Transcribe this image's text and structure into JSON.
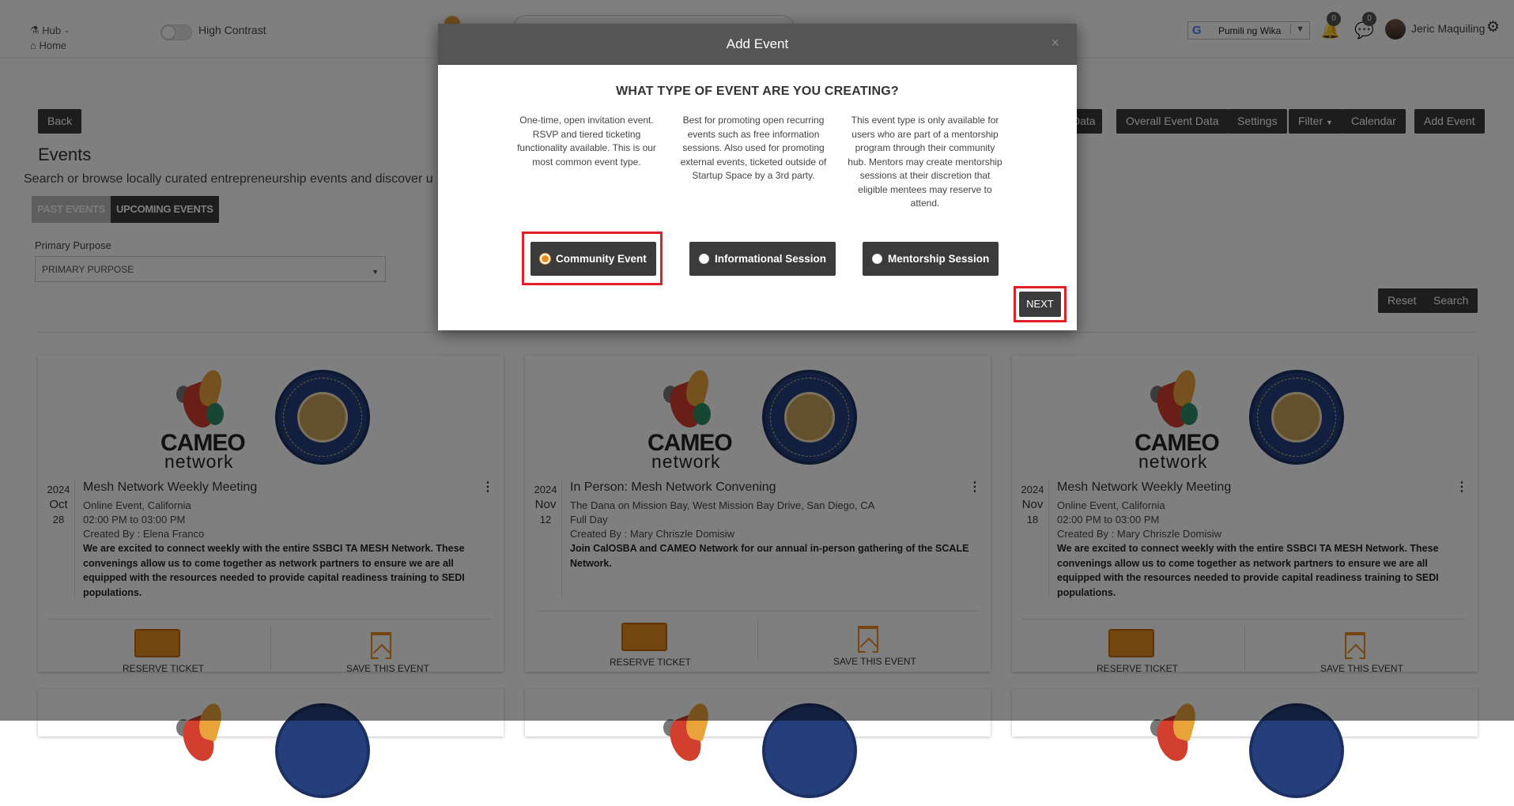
{
  "topbar": {
    "hub_label": "Hub",
    "home_label": "Home",
    "high_contrast_label": "High Contrast",
    "language_label": "Pumili ng Wika",
    "notifications_count": "0",
    "messages_count": "0",
    "user_name": "Jeric Maquiling"
  },
  "page": {
    "back_label": "Back",
    "title": "Events",
    "subtitle": "Search or browse locally curated entrepreneurship events and discover u",
    "toolbar": {
      "data_label": "Data",
      "overall_label": "Overall Event Data",
      "settings_label": "Settings",
      "filter_label": "Filter",
      "calendar_label": "Calendar",
      "add_event_label": "Add Event"
    },
    "tabs": {
      "past": "PAST EVENTS",
      "upcoming": "UPCOMING EVENTS"
    },
    "primary_purpose": {
      "label": "Primary Purpose",
      "value": "PRIMARY PURPOSE"
    },
    "reset_label": "Reset",
    "search_label": "Search"
  },
  "cards": [
    {
      "year": "2024",
      "month": "Oct",
      "day": "28",
      "title": "Mesh Network Weekly Meeting",
      "location": "Online Event, California",
      "time": "02:00 PM to 03:00 PM",
      "created_by": "Created By : Elena Franco",
      "description": "We are excited to connect weekly with the entire  SSBCI TA MESH Network. These convenings allow us to come together as network partners to ensure we are all equipped with the resources needed to provide capital readiness training to SEDI populations.",
      "reserve_label": "RESERVE TICKET",
      "save_label": "SAVE THIS EVENT"
    },
    {
      "year": "2024",
      "month": "Nov",
      "day": "12",
      "title": "In Person: Mesh Network Convening",
      "location": "The Dana on Mission Bay, West Mission Bay Drive, San Diego, CA",
      "time": "Full Day",
      "created_by": "Created By : Mary Chriszle Domisiw",
      "description": "Join CalOSBA and CAMEO Network for our annual in-person gathering of the SCALE Network.",
      "reserve_label": "RESERVE TICKET",
      "save_label": "SAVE THIS EVENT"
    },
    {
      "year": "2024",
      "month": "Nov",
      "day": "18",
      "title": "Mesh Network Weekly Meeting",
      "location": "Online Event, California",
      "time": "02:00 PM to 03:00 PM",
      "created_by": "Created By : Mary Chriszle Domisiw",
      "description": "We are excited to connect weekly with the entire  SSBCI TA MESH Network. These convenings allow us to come together as network partners to ensure we are all equipped with the resources needed to provide capital readiness training to SEDI populations.",
      "reserve_label": "RESERVE TICKET",
      "save_label": "SAVE THIS EVENT"
    }
  ],
  "logo": {
    "cameo": "CAMEO",
    "network": "network"
  },
  "modal": {
    "title": "Add Event",
    "close": "×",
    "question": "WHAT TYPE OF EVENT ARE YOU CREATING?",
    "options": [
      {
        "label": "Community Event",
        "description": "One-time, open invitation event. RSVP and tiered ticketing functionality available. This is our most common event type.",
        "selected": true
      },
      {
        "label": "Informational Session",
        "description": "Best for promoting open recurring events such as free information sessions. Also used for promoting external events, ticketed outside of Startup Space by a 3rd party.",
        "selected": false
      },
      {
        "label": "Mentorship Session",
        "description": "This event type is only available for users who are part of a mentorship program through their community hub. Mentors may create mentorship sessions at their discretion that eligible mentees may reserve to attend.",
        "selected": false
      }
    ],
    "next_label": "NEXT"
  },
  "colors": {
    "accent": "#f08a1c",
    "highlight_box": "#e41e26",
    "dark_button": "#3b3b3b"
  }
}
